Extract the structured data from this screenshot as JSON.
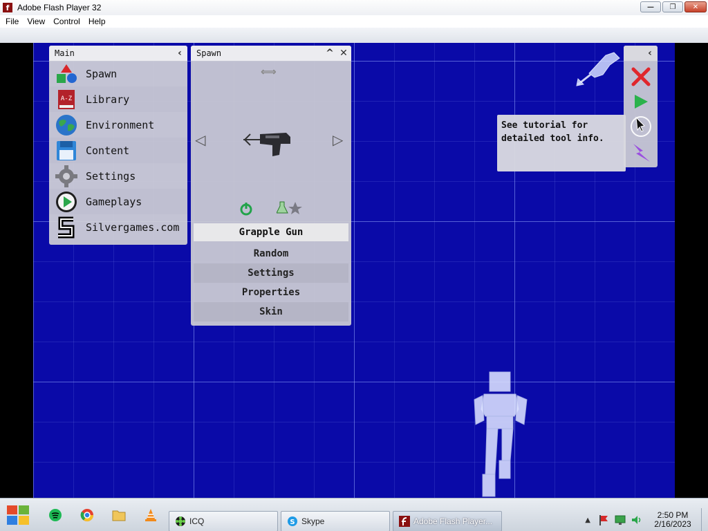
{
  "window": {
    "title": "Adobe Flash Player 32",
    "app_icon": "f",
    "min": "—",
    "max": "❐",
    "close": "✕"
  },
  "menu": {
    "items": [
      "File",
      "View",
      "Control",
      "Help"
    ]
  },
  "main_panel": {
    "title": "Main",
    "collapse": "‹",
    "items": [
      {
        "label": "Spawn",
        "icon": "shapes-icon"
      },
      {
        "label": "Library",
        "icon": "book-az-icon"
      },
      {
        "label": "Environment",
        "icon": "globe-icon"
      },
      {
        "label": "Content",
        "icon": "floppy-disk-icon"
      },
      {
        "label": "Settings",
        "icon": "gear-icon"
      },
      {
        "label": "Gameplays",
        "icon": "play-icon"
      },
      {
        "label": "Silvergames.com",
        "icon": "silvergames-logo-icon"
      }
    ]
  },
  "spawn_panel": {
    "title": "Spawn",
    "collapse": "^",
    "close": "✕",
    "flip": "⟺",
    "prev": "◁",
    "next": "▷",
    "selected_item": "Grapple Gun",
    "rows": [
      "Random",
      "Settings",
      "Properties",
      "Skin"
    ]
  },
  "tools_panel": {
    "collapse": "‹"
  },
  "tooltip": {
    "text": "See tutorial for detailed tool info."
  },
  "taskbar": {
    "tasks": [
      {
        "label": "ICQ",
        "icon": "icq-icon"
      },
      {
        "label": "Skype",
        "icon": "skype-icon"
      },
      {
        "label": "Adobe Flash Player...",
        "icon": "flash-icon"
      }
    ],
    "show_hidden": "▲",
    "clock_time": "2:50 PM",
    "clock_date": "2/16/2023"
  }
}
